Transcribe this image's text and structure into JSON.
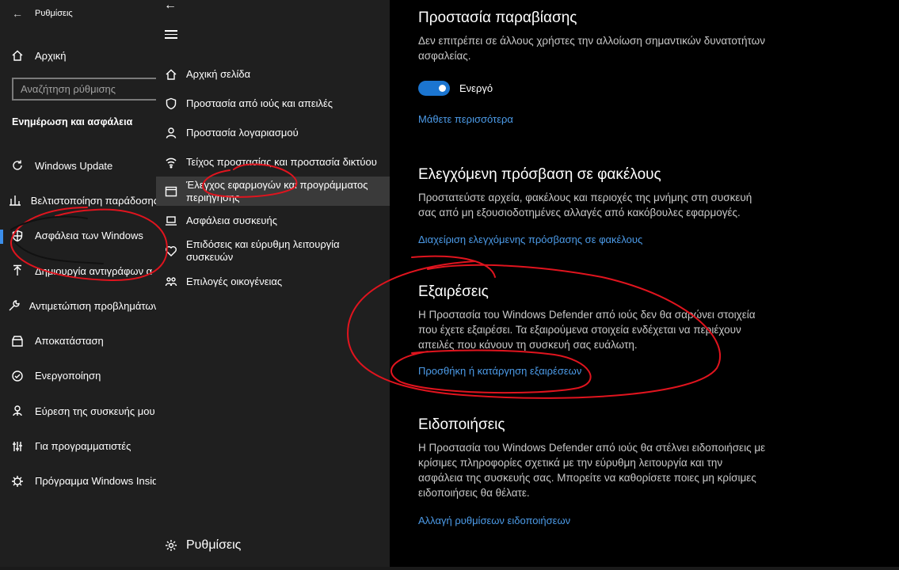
{
  "settings_window": {
    "title": "Ρυθμίσεις",
    "home_label": "Αρχική",
    "search_placeholder": "Αναζήτηση ρύθμισης",
    "section_title": "Ενημέρωση και ασφάλεια",
    "items": [
      {
        "label": "Windows Update",
        "icon": "refresh-icon"
      },
      {
        "label": "Βελτιστοποίηση παράδοσης",
        "icon": "delivery-icon"
      },
      {
        "label": "Ασφάλεια των Windows",
        "icon": "shield-icon",
        "selected": true
      },
      {
        "label": "Δημιουργία αντιγράφων α",
        "icon": "backup-icon"
      },
      {
        "label": "Αντιμετώπιση προβλημάτων",
        "icon": "wrench-icon"
      },
      {
        "label": "Αποκατάσταση",
        "icon": "recovery-icon"
      },
      {
        "label": "Ενεργοποίηση",
        "icon": "activation-icon"
      },
      {
        "label": "Εύρεση της συσκευής μου",
        "icon": "find-device-icon"
      },
      {
        "label": "Για προγραμματιστές",
        "icon": "developer-icon"
      },
      {
        "label": "Πρόγραμμα Windows Insid",
        "icon": "insider-icon"
      }
    ]
  },
  "security_nav": {
    "items": [
      {
        "label": "Αρχική σελίδα",
        "icon": "home-icon"
      },
      {
        "label": "Προστασία από ιούς και απειλές",
        "icon": "shield-icon"
      },
      {
        "label": "Προστασία λογαριασμού",
        "icon": "person-icon"
      },
      {
        "label": "Τείχος προστασίας και προστασία δικτύου",
        "icon": "wifi-icon"
      },
      {
        "label": "Έλεγχος εφαρμογών και προγράμματος περιήγησης",
        "icon": "browser-icon",
        "active": true
      },
      {
        "label": "Ασφάλεια συσκευής",
        "icon": "laptop-icon"
      },
      {
        "label": "Επιδόσεις και εύρυθμη λειτουργία συσκευών",
        "icon": "heart-icon"
      },
      {
        "label": "Επιλογές οικογένειας",
        "icon": "family-icon"
      }
    ],
    "footer_label": "Ρυθμίσεις"
  },
  "main": {
    "tamper": {
      "title": "Προστασία παραβίασης",
      "description": "Δεν επιτρέπει σε άλλους χρήστες την αλλοίωση σημαντικών δυνατοτήτων ασφαλείας.",
      "toggle_label": "Ενεργό",
      "toggle_on": true,
      "link": "Μάθετε περισσότερα"
    },
    "cfa": {
      "title": "Ελεγχόμενη πρόσβαση σε φακέλους",
      "description": "Προστατεύστε αρχεία, φακέλους και περιοχές της μνήμης στη συσκευή σας από μη εξουσιοδοτημένες αλλαγές από κακόβουλες εφαρμογές.",
      "link": "Διαχείριση ελεγχόμενης πρόσβασης σε φακέλους"
    },
    "exclusions": {
      "title": "Εξαιρέσεις",
      "description": "Η Προστασία του Windows Defender από ιούς δεν θα σαρώνει στοιχεία που έχετε εξαιρέσει. Τα εξαιρούμενα στοιχεία ενδέχεται να περιέχουν απειλές που κάνουν τη συσκευή σας ευάλωτη.",
      "link": "Προσθήκη ή κατάργηση εξαιρέσεων"
    },
    "notifications": {
      "title": "Ειδοποιήσεις",
      "description": "Η Προστασία του Windows Defender από ιούς θα στέλνει ειδοποιήσεις με κρίσιμες πληροφορίες σχετικά με την εύρυθμη λειτουργία και την ασφάλεια της συσκευής σας. Μπορείτε να καθορίσετε ποιες μη κρίσιμες ειδοποιήσεις θα θέλατε.",
      "link": "Αλλαγή ρυθμίσεων ειδοποιήσεων"
    }
  },
  "colors": {
    "accent": "#1b75d0",
    "link": "#4c9be8",
    "annotation": "#e0141e"
  }
}
